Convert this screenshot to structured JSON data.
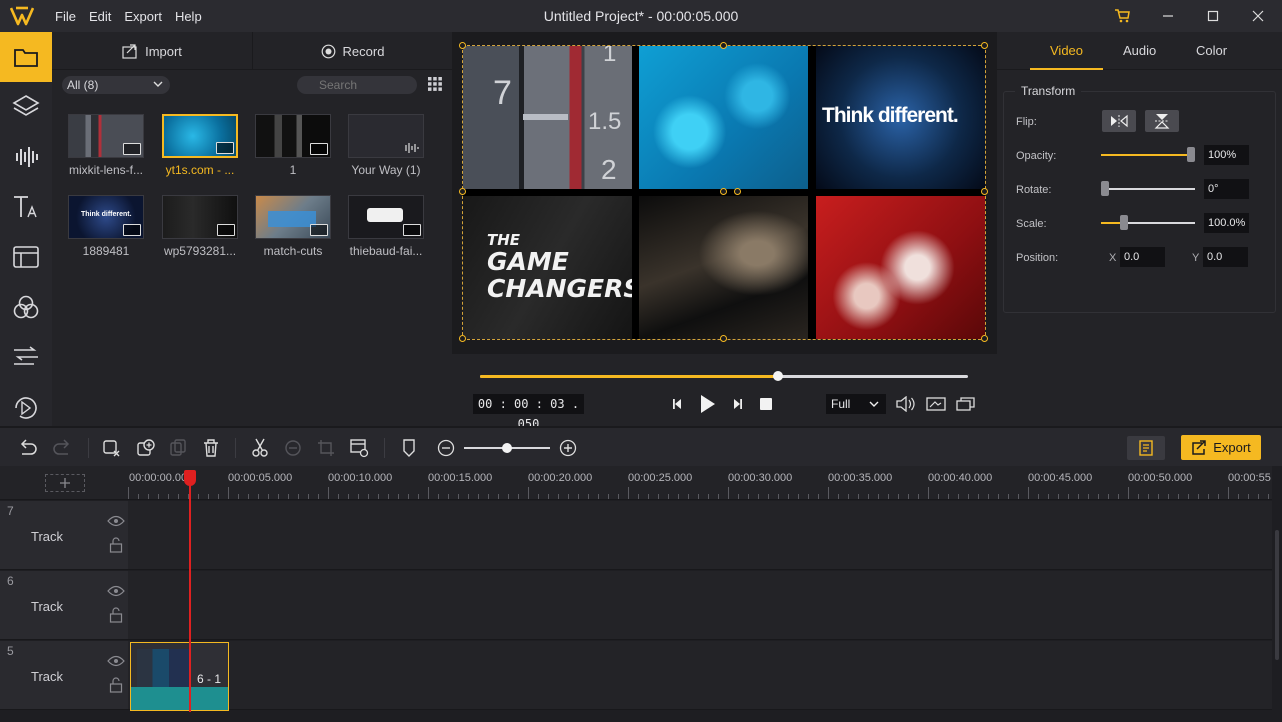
{
  "app": {
    "title": "Untitled Project* - 00:00:05.000",
    "menu": [
      "File",
      "Edit",
      "Export",
      "Help"
    ]
  },
  "media": {
    "import_label": "Import",
    "record_label": "Record",
    "filter_value": "All (8)",
    "search_placeholder": "Search",
    "items": [
      {
        "label": "mixkit-lens-f..."
      },
      {
        "label": "yt1s.com - ..."
      },
      {
        "label": "1"
      },
      {
        "label": "Your Way (1)"
      },
      {
        "label": "1889481"
      },
      {
        "label": "wp5793281..."
      },
      {
        "label": "match-cuts"
      },
      {
        "label": "thiebaud-fai..."
      }
    ],
    "selected_index": 1
  },
  "preview": {
    "think_text": "Think different.",
    "game_line1": "THE",
    "game_line2": "GAME",
    "game_line3": "CHANGERS",
    "ruler_digits": [
      "7",
      "1",
      "1.5",
      "2"
    ],
    "current_time": "00 : 00 : 03 . 050",
    "progress_fraction": 0.61,
    "zoom_value": "Full"
  },
  "properties": {
    "tabs": [
      "Video",
      "Audio",
      "Color"
    ],
    "active_tab": "Video",
    "group_title": "Transform",
    "flip_label": "Flip:",
    "opacity_label": "Opacity:",
    "opacity_value": "100%",
    "opacity_fraction": 1.0,
    "rotate_label": "Rotate:",
    "rotate_value": "0°",
    "rotate_fraction": 0.0,
    "scale_label": "Scale:",
    "scale_value": "100.0%",
    "scale_fraction": 0.24,
    "position_label": "Position:",
    "x_label": "X",
    "x_value": "0.0",
    "y_label": "Y",
    "y_value": "0.0"
  },
  "toolbar": {
    "export_label": "Export",
    "zoom_fraction": 0.5
  },
  "timeline": {
    "ruler_labels": [
      "00:00:00.000",
      "00:00:05.000",
      "00:00:10.000",
      "00:00:15.000",
      "00:00:20.000",
      "00:00:25.000",
      "00:00:30.000",
      "00:00:35.000",
      "00:00:40.000",
      "00:00:45.000",
      "00:00:50.000",
      "00:00:55"
    ],
    "tracks": [
      {
        "number": "7",
        "name": "Track"
      },
      {
        "number": "6",
        "name": "Track"
      },
      {
        "number": "5",
        "name": "Track"
      }
    ],
    "clip_label": "6 - 1"
  },
  "colors": {
    "accent": "#f5b921",
    "playhead": "#e02020",
    "panel": "#232327"
  }
}
